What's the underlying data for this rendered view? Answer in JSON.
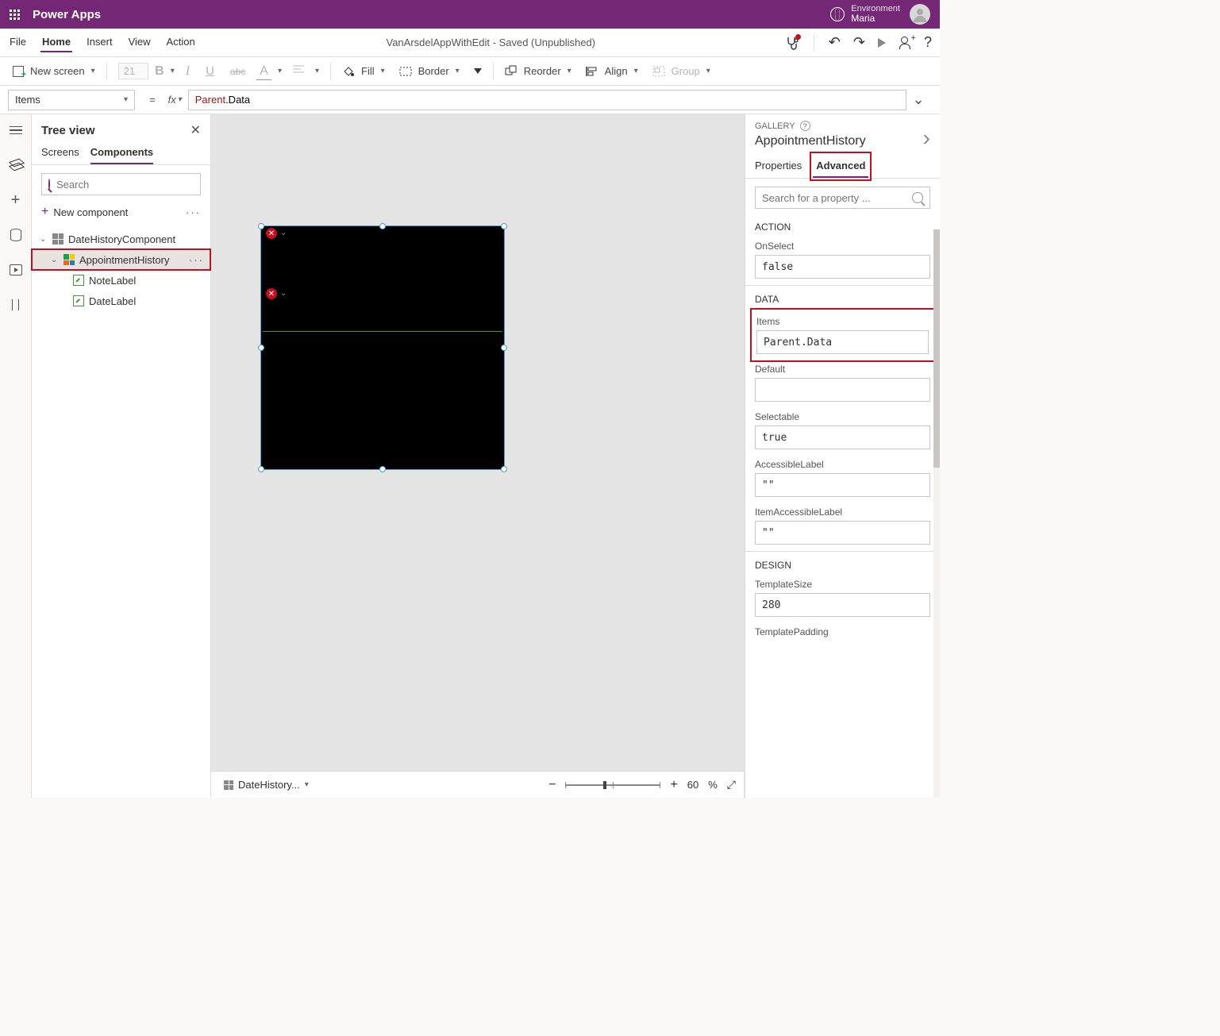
{
  "header": {
    "app_title": "Power Apps",
    "env_label": "Environment",
    "env_name": "Maria"
  },
  "menubar": {
    "items": [
      "File",
      "Home",
      "Insert",
      "View",
      "Action"
    ],
    "active": "Home",
    "doc_status": "VanArsdelAppWithEdit - Saved (Unpublished)"
  },
  "toolbar": {
    "new_screen": "New screen",
    "font_size": "21",
    "fill": "Fill",
    "border": "Border",
    "reorder": "Reorder",
    "align": "Align",
    "group": "Group"
  },
  "formula": {
    "property": "Items",
    "expr_obj": "Parent",
    "expr_rest": ".Data"
  },
  "tree": {
    "title": "Tree view",
    "tabs": [
      "Screens",
      "Components"
    ],
    "active_tab": "Components",
    "search_placeholder": "Search",
    "new_component": "New component",
    "root": "DateHistoryComponent",
    "selected": "AppointmentHistory",
    "children": [
      "NoteLabel",
      "DateLabel"
    ]
  },
  "canvas": {
    "bottom_label": "DateHistory...",
    "zoom_value": "60",
    "zoom_unit": "%"
  },
  "props": {
    "type": "GALLERY",
    "name": "AppointmentHistory",
    "tabs": [
      "Properties",
      "Advanced"
    ],
    "active_tab": "Advanced",
    "search_placeholder": "Search for a property ...",
    "sections": {
      "action": "ACTION",
      "data": "DATA",
      "design": "DESIGN"
    },
    "fields": {
      "OnSelect": {
        "label": "OnSelect",
        "value": "false"
      },
      "Items": {
        "label": "Items",
        "value": "Parent.Data"
      },
      "Default": {
        "label": "Default",
        "value": ""
      },
      "Selectable": {
        "label": "Selectable",
        "value": "true"
      },
      "AccessibleLabel": {
        "label": "AccessibleLabel",
        "value": "\"\""
      },
      "ItemAccessibleLabel": {
        "label": "ItemAccessibleLabel",
        "value": "\"\""
      },
      "TemplateSize": {
        "label": "TemplateSize",
        "value": "280"
      },
      "TemplatePadding": {
        "label": "TemplatePadding",
        "value": ""
      }
    }
  }
}
